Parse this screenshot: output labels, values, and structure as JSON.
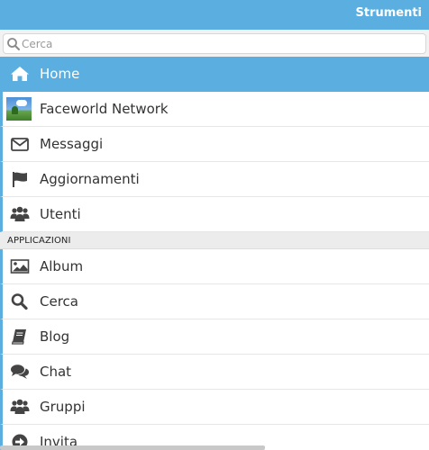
{
  "header": {
    "tools_label": "Strumenti"
  },
  "search": {
    "placeholder": "Cerca"
  },
  "menu": {
    "items": [
      {
        "label": "Home",
        "icon": "home-icon"
      },
      {
        "label": "Faceworld Network",
        "icon": "landscape-thumbnail"
      },
      {
        "label": "Messaggi",
        "icon": "envelope-icon"
      },
      {
        "label": "Aggiornamenti",
        "icon": "flag-icon"
      },
      {
        "label": "Utenti",
        "icon": "users-icon"
      }
    ],
    "section_title": "APPLICAZIONI",
    "apps": [
      {
        "label": "Album",
        "icon": "picture-icon"
      },
      {
        "label": "Cerca",
        "icon": "search-icon"
      },
      {
        "label": "Blog",
        "icon": "book-icon"
      },
      {
        "label": "Chat",
        "icon": "chat-icon"
      },
      {
        "label": "Gruppi",
        "icon": "users-icon"
      },
      {
        "label": "Invita",
        "icon": "arrow-circle-icon"
      }
    ]
  },
  "colors": {
    "accent": "#5aafe0",
    "icon": "#444444"
  }
}
